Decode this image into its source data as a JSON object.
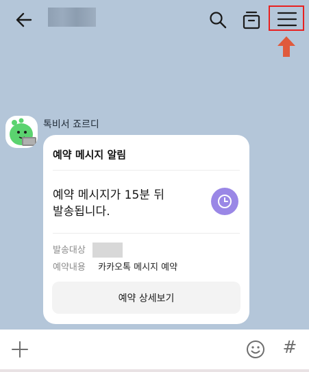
{
  "chat": {
    "sender": "톡비서 죠르디"
  },
  "card": {
    "title": "예약 메시지 알림",
    "message": "예약 메시지가 15분 뒤\n발송됩니다.",
    "recipient_label": "발송대상",
    "content_label": "예약내용",
    "content_value": "카카오톡 메시지 예약",
    "detail_button": "예약 상세보기"
  },
  "composer": {
    "hash_symbol": "#"
  },
  "icons": {
    "back": "back-arrow-icon",
    "search": "search-icon",
    "drawer": "chat-drawer-icon",
    "menu": "hamburger-menu-icon",
    "clock": "clock-icon",
    "plus": "plus-icon",
    "emoji": "emoji-icon",
    "hash": "hash-icon"
  },
  "colors": {
    "background": "#b4c6d9",
    "highlight": "#e8201f",
    "arrow": "#e05a3c",
    "clock_badge": "#9a87e6"
  }
}
